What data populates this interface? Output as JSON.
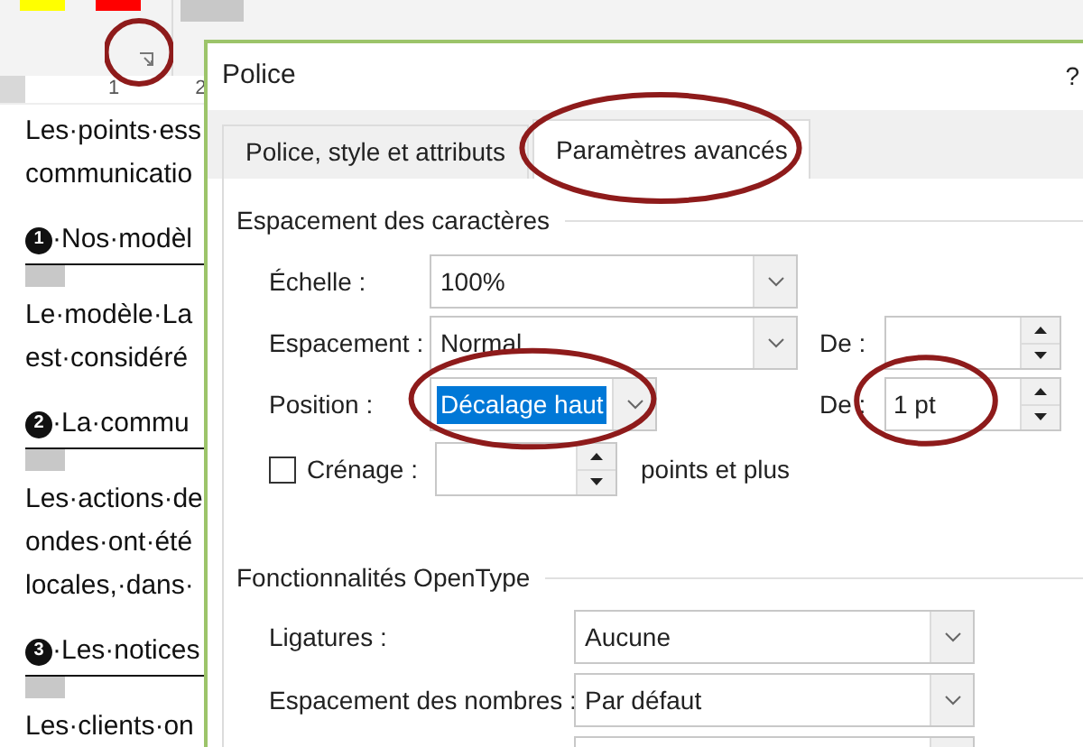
{
  "ribbon": {
    "swatches": [
      {
        "color": "#ffff00"
      },
      {
        "color": "#ff0000"
      }
    ]
  },
  "ruler": {
    "marks": [
      "1",
      "2"
    ]
  },
  "document": {
    "paragraphs": [
      {
        "kind": "text",
        "lines": [
          "Les·points·ess",
          "communicatio"
        ]
      },
      {
        "kind": "heading",
        "bullet": "1",
        "text": "·Nos·modèl"
      },
      {
        "kind": "text",
        "lines": [
          "Le·modèle·La",
          "est·considéré"
        ]
      },
      {
        "kind": "heading",
        "bullet": "2",
        "text": "·La·commu"
      },
      {
        "kind": "text",
        "lines": [
          "Les·actions·de",
          "ondes·ont·été",
          "locales,·dans·"
        ]
      },
      {
        "kind": "heading",
        "bullet": "3",
        "text": "·Les·notices"
      },
      {
        "kind": "text",
        "lines": [
          "Les·clients·on"
        ]
      }
    ]
  },
  "dialog": {
    "title": "Police",
    "help": "?",
    "tabs": [
      {
        "label": "Police, style et attributs",
        "selected": false
      },
      {
        "label": "Paramètres avancés",
        "selected": true
      }
    ],
    "spacing": {
      "title": "Espacement des caractères",
      "scale": {
        "label": "Échelle :",
        "value": "100%"
      },
      "spacing": {
        "label": "Espacement :",
        "value": "Normal",
        "by_label": "De :"
      },
      "position": {
        "label": "Position :",
        "value": "Décalage haut",
        "highlighted": true,
        "by_label": "De :",
        "by_value": "1 pt"
      },
      "kerning": {
        "label": "Crénage :",
        "checked": false,
        "suffix": "points et plus"
      }
    },
    "opentype": {
      "title": "Fonctionnalités OpenType",
      "rows": [
        {
          "label": "Ligatures :",
          "value": "Aucune"
        },
        {
          "label": "Espacement des nombres :",
          "value": "Par défaut"
        }
      ]
    }
  },
  "annotations": [
    {
      "kind": "ellipse"
    },
    {
      "kind": "ellipse"
    },
    {
      "kind": "ellipse"
    },
    {
      "kind": "ellipse"
    }
  ]
}
